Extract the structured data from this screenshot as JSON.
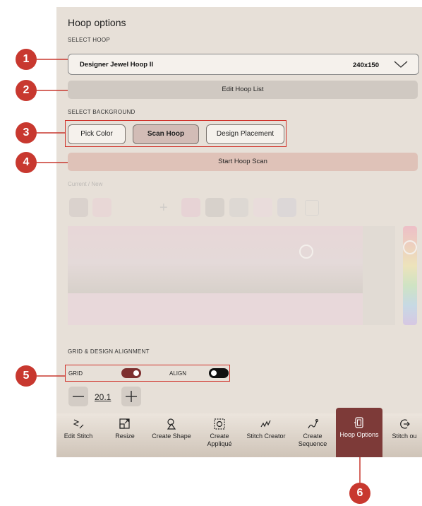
{
  "panel": {
    "title": "Hoop options",
    "select_hoop_label": "SELECT HOOP",
    "hoop_name": "Designer Jewel Hoop II",
    "hoop_size": "240x150",
    "edit_hoop_list": "Edit Hoop List",
    "select_background_label": "SELECT BACKGROUND",
    "background_options": [
      "Pick Color",
      "Scan Hoop",
      "Design Placement"
    ],
    "selected_background": "Scan Hoop",
    "start_hoop_scan": "Start Hoop Scan",
    "current_new_label": "Current / New",
    "grid_section_label": "GRID & DESIGN ALIGNMENT",
    "grid_label": "GRID",
    "grid_on": true,
    "align_label": "ALIGN",
    "align_on": false,
    "grid_value": "20.1"
  },
  "toolbar": {
    "items": [
      {
        "label": "Edit Stitch",
        "icon": "edit-stitch-icon"
      },
      {
        "label": "Resize",
        "icon": "resize-icon"
      },
      {
        "label": "Create Shape",
        "icon": "create-shape-icon"
      },
      {
        "label": "Create Appliqué",
        "icon": "applique-icon"
      },
      {
        "label": "Stitch Creator",
        "icon": "stitch-creator-icon"
      },
      {
        "label": "Create Sequence",
        "icon": "sequence-icon"
      },
      {
        "label": "Hoop Options",
        "icon": "hoop-options-icon"
      },
      {
        "label": "Stitch ou",
        "icon": "stitch-out-icon"
      }
    ],
    "active": "Hoop Options"
  },
  "callouts": [
    "1",
    "2",
    "3",
    "4",
    "5",
    "6"
  ],
  "colors": {
    "panel_bg": "#e7e0d8",
    "accent": "#7d3a38",
    "callout": "#c8382f",
    "scan_button": "#dfc2b8"
  }
}
